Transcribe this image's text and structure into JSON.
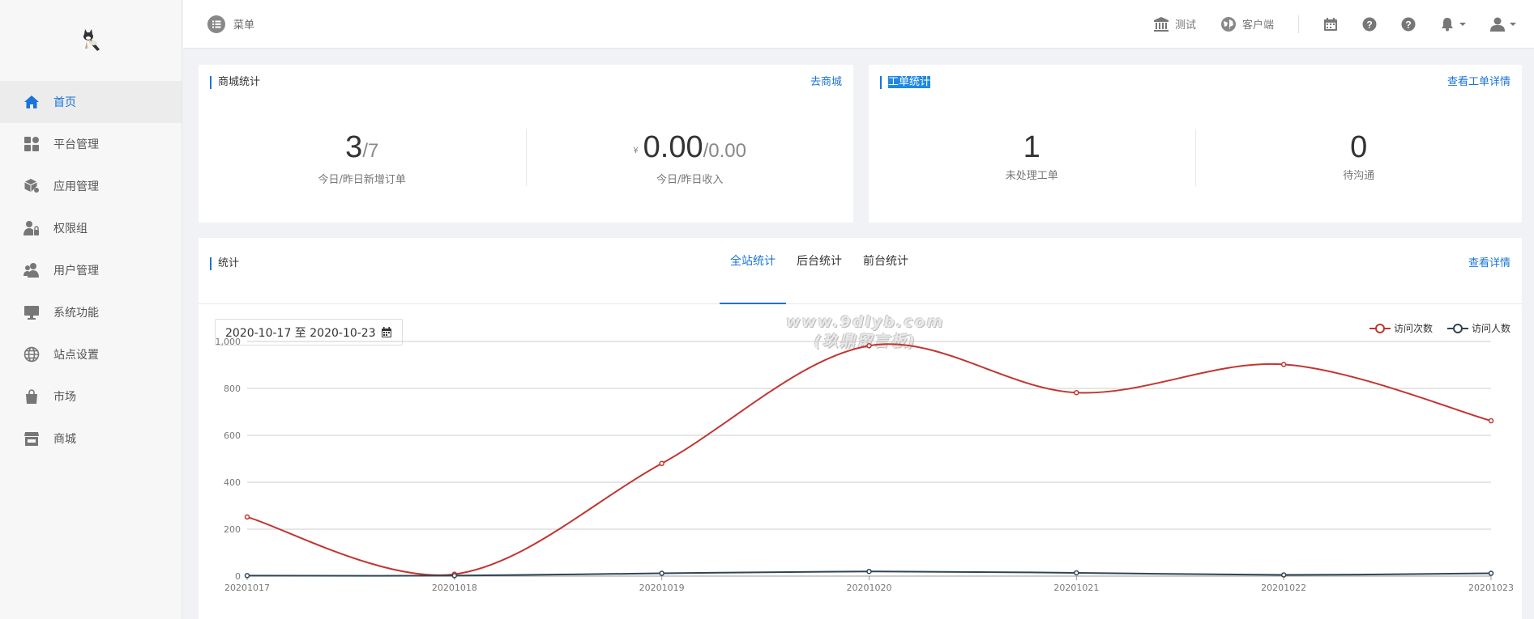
{
  "sidebar": {
    "items": [
      {
        "label": "首页",
        "icon": "home-icon",
        "active": true
      },
      {
        "label": "平台管理",
        "icon": "apps-icon"
      },
      {
        "label": "应用管理",
        "icon": "cube-icon"
      },
      {
        "label": "权限组",
        "icon": "user-lock-icon"
      },
      {
        "label": "用户管理",
        "icon": "users-icon"
      },
      {
        "label": "系统功能",
        "icon": "monitor-icon"
      },
      {
        "label": "站点设置",
        "icon": "globe-icon"
      },
      {
        "label": "市场",
        "icon": "bag-icon"
      },
      {
        "label": "商城",
        "icon": "store-icon"
      }
    ]
  },
  "topbar": {
    "menu_label": "菜单",
    "link_test": "测试",
    "link_client": "客户端"
  },
  "mall": {
    "title": "商城统计",
    "link": "去商城",
    "orders_today": "3",
    "orders_yesterday": "/7",
    "orders_label": "今日/昨日新增订单",
    "currency": "¥",
    "income_today": "0.00",
    "income_yesterday": "/0.00",
    "income_label": "今日/昨日收入"
  },
  "tickets": {
    "title": "工单统计",
    "link": "查看工单详情",
    "pending": "1",
    "pending_label": "未处理工单",
    "to_communicate": "0",
    "to_communicate_label": "待沟通"
  },
  "stats": {
    "title": "统计",
    "link": "查看详情",
    "tabs": [
      "全站统计",
      "后台统计",
      "前台统计"
    ],
    "active_tab": 0,
    "date_range": "2020-10-17 至 2020-10-23"
  },
  "watermark": {
    "line1": "www.9dlyb.com",
    "line2": "(玖鼎留言板)"
  },
  "colors": {
    "accent": "#1a73d9",
    "series_visits": "#c23531",
    "series_visitors": "#2f4554"
  },
  "chart_data": {
    "type": "line",
    "x": [
      "20201017",
      "20201018",
      "20201019",
      "20201020",
      "20201021",
      "20201022",
      "20201023"
    ],
    "series": [
      {
        "name": "访问次数",
        "values": [
          252,
          8,
          480,
          982,
          782,
          902,
          662
        ]
      },
      {
        "name": "访问人数",
        "values": [
          2,
          2,
          12,
          20,
          14,
          5,
          12
        ]
      }
    ],
    "ylim": [
      0,
      1000
    ],
    "yticks": [
      0,
      200,
      400,
      600,
      800,
      1000
    ],
    "ytick_labels": [
      "0",
      "200",
      "400",
      "600",
      "800",
      "1,000"
    ],
    "grid": true,
    "legend": "top-right",
    "smooth": true
  }
}
